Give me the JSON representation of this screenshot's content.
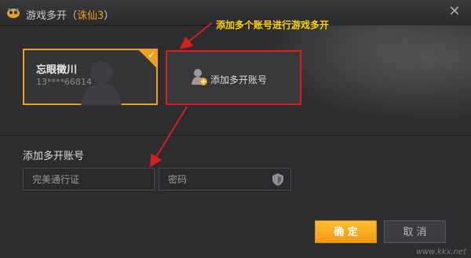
{
  "window": {
    "title_prefix": "游戏多开（",
    "title_game": "诛仙3",
    "title_suffix": "）",
    "close_icon": "close-icon"
  },
  "annotation": {
    "text": "添加多个账号进行游戏多开"
  },
  "accounts": [
    {
      "name": "忘眼徵川",
      "number": "13****66814",
      "selected": true
    }
  ],
  "add_card": {
    "label": "添加多开账号",
    "icon": "add-user-icon"
  },
  "form": {
    "section_title": "添加多开账号",
    "account_placeholder": "完美通行证",
    "password_placeholder": "密码",
    "password_icon": "shield-icon"
  },
  "buttons": {
    "ok_label": "确 定",
    "cancel_label": "取 消"
  },
  "watermark": "www.kkx.net",
  "colors": {
    "accent": "#f0a020",
    "annotation": "#ffd400",
    "highlight_border": "#d41f1f",
    "background": "#2d2d30"
  }
}
